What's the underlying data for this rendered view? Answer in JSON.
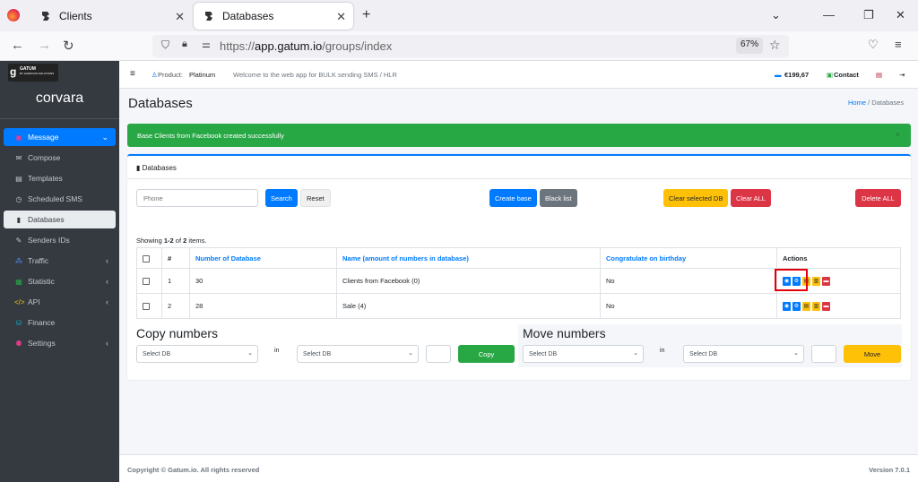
{
  "browser": {
    "tabs": [
      {
        "title": "Clients"
      },
      {
        "title": "Databases"
      }
    ],
    "url_prefix": "https://",
    "url_host": "app.gatum.io",
    "url_path": "/groups/index",
    "zoom": "67%"
  },
  "sidebar": {
    "logo_text": "GATUM",
    "logo_sub": "BY GANNOUS SOLUTIONS",
    "brand": "corvara",
    "items": [
      {
        "label": "Message",
        "icon": "message-icon"
      },
      {
        "label": "Compose",
        "icon": "envelope-icon"
      },
      {
        "label": "Templates",
        "icon": "templates-icon"
      },
      {
        "label": "Scheduled SMS",
        "icon": "clock-icon"
      },
      {
        "label": "Databases",
        "icon": "database-icon"
      },
      {
        "label": "Senders IDs",
        "icon": "feather-icon"
      },
      {
        "label": "Traffic",
        "icon": "traffic-icon"
      },
      {
        "label": "Statistic",
        "icon": "statistic-icon"
      },
      {
        "label": "API",
        "icon": "code-icon"
      },
      {
        "label": "Finance",
        "icon": "finance-icon"
      },
      {
        "label": "Settings",
        "icon": "users-icon"
      }
    ]
  },
  "topnav": {
    "product_label": "Product:",
    "product_value": "Platinum",
    "welcome": "Welcome to the web app for BULK sending SMS / HLR",
    "balance": "€199,67",
    "contact": "Contact"
  },
  "page": {
    "title": "Databases",
    "breadcrumb_home": "Home",
    "breadcrumb_sep": "/",
    "breadcrumb_current": "Databases",
    "alert": "Base Clients from Facebook created successfully",
    "alert_close": "×"
  },
  "card": {
    "header": "Databases",
    "phone_placeholder": "Phone",
    "search": "Search",
    "reset": "Reset",
    "create_base": "Create base",
    "black_list": "Black list",
    "clear_selected_db": "Clear selected DB",
    "clear_all": "Clear ALL",
    "delete_all": "Delete ALL",
    "showing_prefix": "Showing ",
    "showing_range": "1-2",
    "showing_of": " of ",
    "showing_total": "2",
    "showing_suffix": " items."
  },
  "table": {
    "headers": [
      "#",
      "Number of Database",
      "Name (amount of numbers in database)",
      "Congratulate on birthday",
      "Actions"
    ],
    "rows": [
      {
        "index": "1",
        "number": "30",
        "name": "Clients from Facebook (0)",
        "birthday": "No"
      },
      {
        "index": "2",
        "number": "28",
        "name": "Sale (4)",
        "birthday": "No"
      }
    ]
  },
  "copy": {
    "title": "Copy numbers",
    "select1": "Select DB",
    "in": "in",
    "select2": "Select DB",
    "button": "Copy"
  },
  "move": {
    "title": "Move numbers",
    "select1": "Select DB",
    "in": "in",
    "select2": "Select DB",
    "button": "Move"
  },
  "footer": {
    "copyright": "Copyright © Gatum.io. All rights reserved",
    "version": "Version 7.0.1"
  },
  "colors": {
    "primary": "#007bff",
    "success": "#28a745",
    "warning": "#ffc107",
    "danger": "#dc3545",
    "sidebar": "#343a40",
    "highlight": "#e3000b"
  }
}
